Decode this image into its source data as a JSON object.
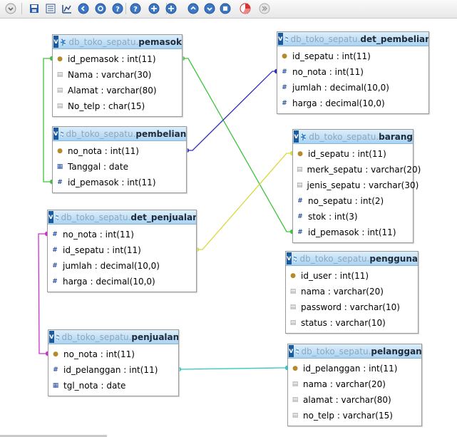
{
  "db": "db_toko_sepatu",
  "toolbar": [
    "toggle-icon",
    "save-icon",
    "export-icon",
    "chart-icon",
    "arrow-left-icon",
    "arrow-right-icon",
    "help-icon",
    "help2-icon",
    "move-icon",
    "move2-icon",
    "arrow-up-icon",
    "arrow-down-icon",
    "page-icon",
    "pie-icon",
    "forward-icon"
  ],
  "tables": [
    {
      "name": "pemasok",
      "columns": [
        {
          "name": "id_pemasok",
          "type": "int(11)",
          "icon": "key"
        },
        {
          "name": "Nama",
          "type": "varchar(30)",
          "icon": "text"
        },
        {
          "name": "Alamat",
          "type": "varchar(80)",
          "icon": "text"
        },
        {
          "name": "No_telp",
          "type": "char(15)",
          "icon": "text"
        }
      ]
    },
    {
      "name": "pembelian",
      "columns": [
        {
          "name": "no_nota",
          "type": "int(11)",
          "icon": "key"
        },
        {
          "name": "Tanggal",
          "type": "date",
          "icon": "date"
        },
        {
          "name": "id_pemasok",
          "type": "int(11)",
          "icon": "int"
        }
      ]
    },
    {
      "name": "det_penjualan",
      "columns": [
        {
          "name": "no_nota",
          "type": "int(11)",
          "icon": "int"
        },
        {
          "name": "id_sepatu",
          "type": "int(11)",
          "icon": "int"
        },
        {
          "name": "jumlah",
          "type": "decimal(10,0)",
          "icon": "int"
        },
        {
          "name": "harga",
          "type": "decimal(10,0)",
          "icon": "int"
        }
      ]
    },
    {
      "name": "penjualan",
      "columns": [
        {
          "name": "no_nota",
          "type": "int(11)",
          "icon": "key"
        },
        {
          "name": "id_pelanggan",
          "type": "int(11)",
          "icon": "int"
        },
        {
          "name": "tgl_nota",
          "type": "date",
          "icon": "date"
        }
      ]
    },
    {
      "name": "det_pembelian",
      "columns": [
        {
          "name": "id_sepatu",
          "type": "int(11)",
          "icon": "key"
        },
        {
          "name": "no_nota",
          "type": "int(11)",
          "icon": "int"
        },
        {
          "name": "jumlah",
          "type": "decimal(10,0)",
          "icon": "int"
        },
        {
          "name": "harga",
          "type": "decimal(10,0)",
          "icon": "int"
        }
      ]
    },
    {
      "name": "barang",
      "columns": [
        {
          "name": "id_sepatu",
          "type": "int(11)",
          "icon": "key"
        },
        {
          "name": "merk_sepatu",
          "type": "varchar(20)",
          "icon": "text"
        },
        {
          "name": "jenis_sepatu",
          "type": "varchar(30)",
          "icon": "text"
        },
        {
          "name": "no_sepatu",
          "type": "int(2)",
          "icon": "int"
        },
        {
          "name": "stok",
          "type": "int(3)",
          "icon": "int"
        },
        {
          "name": "id_pemasok",
          "type": "int(11)",
          "icon": "int"
        }
      ]
    },
    {
      "name": "pengguna",
      "columns": [
        {
          "name": "id_user",
          "type": "int(11)",
          "icon": "key"
        },
        {
          "name": "nama",
          "type": "varchar(20)",
          "icon": "text"
        },
        {
          "name": "password",
          "type": "varchar(10)",
          "icon": "text"
        },
        {
          "name": "status",
          "type": "varchar(10)",
          "icon": "text"
        }
      ]
    },
    {
      "name": "pelanggan",
      "columns": [
        {
          "name": "id_pelanggan",
          "type": "int(11)",
          "icon": "key"
        },
        {
          "name": "nama",
          "type": "varchar(20)",
          "icon": "text"
        },
        {
          "name": "alamat",
          "type": "varchar(80)",
          "icon": "text"
        },
        {
          "name": "no_telp",
          "type": "varchar(15)",
          "icon": "text"
        }
      ]
    }
  ],
  "relations": [
    {
      "from": "pembelian.id_pemasok",
      "to": "pemasok.id_pemasok",
      "color": "#3cc43c"
    },
    {
      "from": "barang.id_pemasok",
      "to": "pemasok.id_pemasok",
      "color": "#3cc43c"
    },
    {
      "from": "det_pembelian.no_nota",
      "to": "pembelian.no_nota",
      "color": "#2e2eb8"
    },
    {
      "from": "det_penjualan.id_sepatu",
      "to": "barang.id_sepatu",
      "color": "#d8d83a"
    },
    {
      "from": "det_penjualan.no_nota",
      "to": "penjualan.no_nota",
      "color": "#d02ed0"
    },
    {
      "from": "penjualan.id_pelanggan",
      "to": "pelanggan.id_pelanggan",
      "color": "#2ec8c0"
    }
  ]
}
